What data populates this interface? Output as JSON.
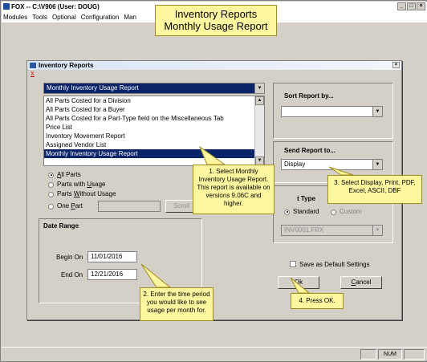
{
  "app": {
    "title": "FOX -- C:\\V906  (User: DOUG)",
    "window_buttons": [
      "_",
      "□",
      "×"
    ],
    "menu": [
      "Modules",
      "Tools",
      "Optional",
      "Configuration",
      "Man"
    ],
    "status": {
      "num": "NUM"
    }
  },
  "banner": {
    "line1": "Inventory Reports",
    "line2": "Monthly Usage Report"
  },
  "dialog": {
    "title": "Inventory Reports",
    "close": "×",
    "x_link": "X",
    "report_combo_value": "Monthly Inventory Usage Report",
    "report_list": [
      "All Parts Costed for a Division",
      "All Parts Costed for a Buyer",
      "All Parts Costed for a Part-Type field on the Miscellaneous Tab",
      "Price List",
      "Inventory Movement Report",
      "Assigned Vendor List",
      "Monthly Inventory Usage Report"
    ],
    "selected_index": 6,
    "parts_filter": {
      "options": [
        {
          "pre": "",
          "u": "A",
          "post": "ll Parts"
        },
        {
          "pre": "Parts with ",
          "u": "U",
          "post": "sage"
        },
        {
          "pre": "Parts ",
          "u": "W",
          "post": "ithout Usage"
        },
        {
          "pre": "One ",
          "u": "P",
          "post": "art"
        }
      ],
      "selected": 0,
      "scroll_button": "Scroll"
    },
    "date_range": {
      "heading": "Date Range",
      "begin_label": "Begin On",
      "begin_value": "11/01/2016",
      "end_label": "End On",
      "end_value": "12/21/2016"
    },
    "sort": {
      "label": "Sort Report by...",
      "value": ""
    },
    "send": {
      "label": "Send Report to...",
      "value": "Display"
    },
    "format": {
      "label": "t Type",
      "standard": "Standard",
      "custom": "Custom",
      "file_value": "INV0001.FRX"
    },
    "save_default": "Save as Default Settings",
    "ok": {
      "u": "O",
      "post": "k"
    },
    "cancel": {
      "u": "C",
      "post": "ancel"
    }
  },
  "callouts": {
    "c1": "1. Select Monthly Inventory Usage Report.  This report is available on versions 9.06C and higher.",
    "c2": "2. Enter the time period you would like to see usage per month for.",
    "c3": "3. Select Display, Print, PDF, Excel, ASCII, DBF",
    "c4": "4. Press OK."
  },
  "colors": {
    "callout_bg": "#fff7a0",
    "selection": "#0a246a"
  }
}
